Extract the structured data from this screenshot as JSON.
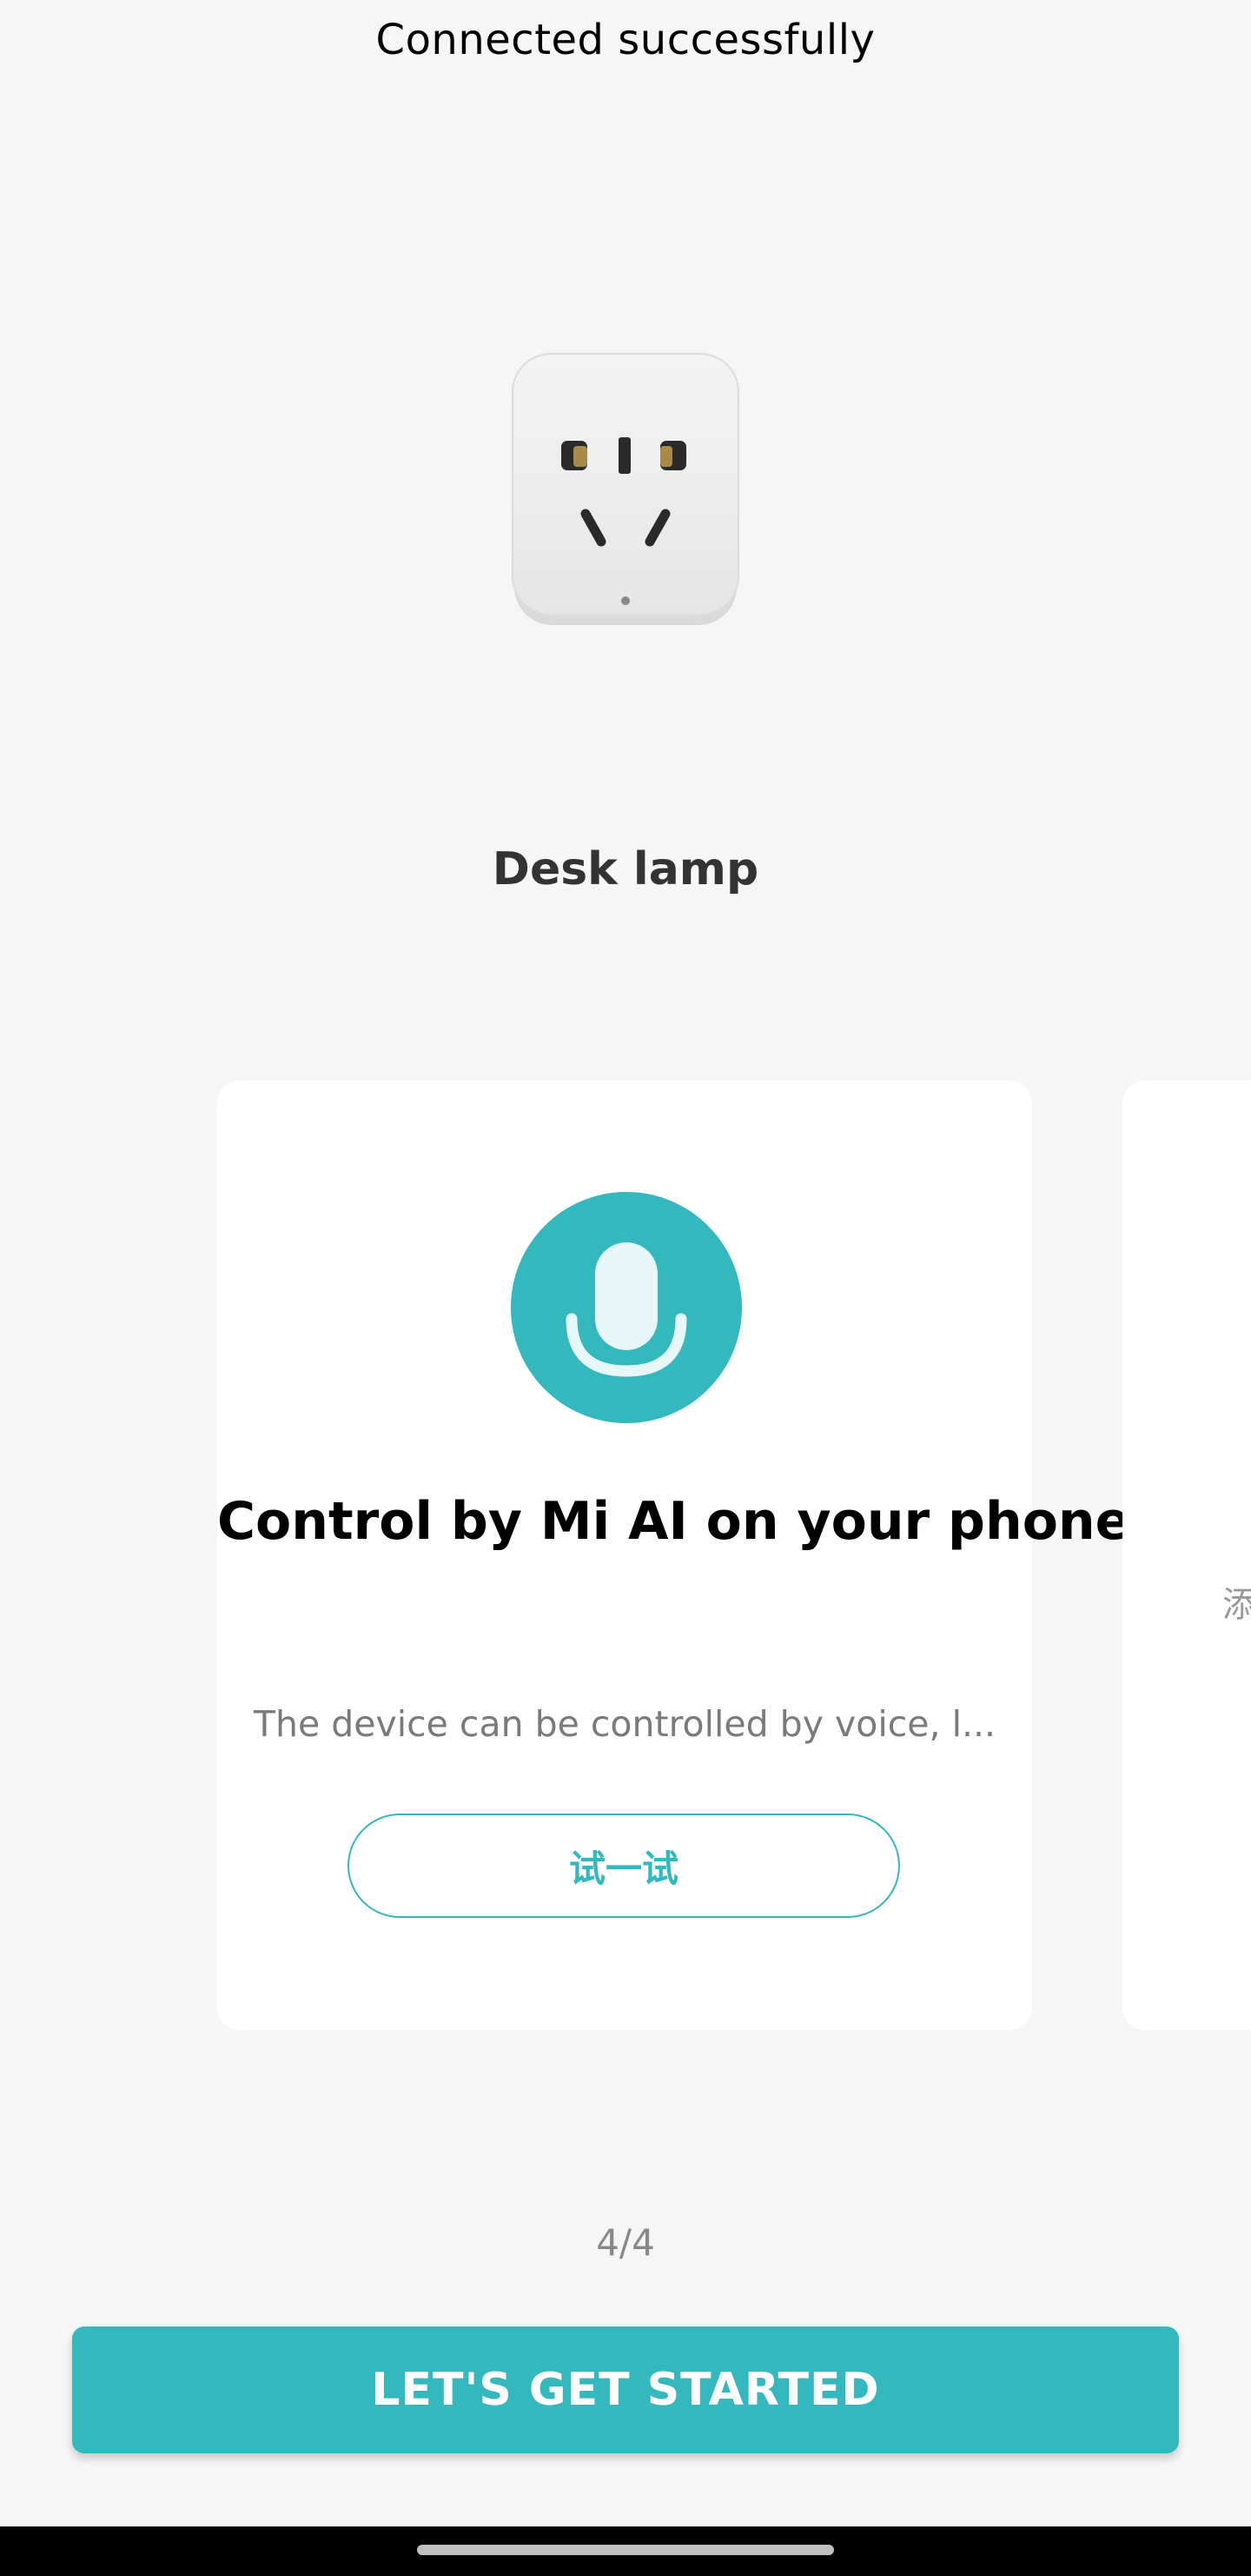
{
  "header": {
    "title": "Connected successfully"
  },
  "device": {
    "name": "Desk lamp",
    "image_icon": "smart-plug-icon"
  },
  "card": {
    "icon": "microphone-icon",
    "title": "Control by Mi AI on your phone",
    "description": "The device can be controlled by voice, l...",
    "button_label": "试一试"
  },
  "next_card": {
    "partial_text": "添"
  },
  "pagination": {
    "label": "4/4"
  },
  "footer": {
    "start_button_label": "LET'S GET STARTED"
  },
  "colors": {
    "accent": "#33b8bd",
    "background": "#f6f6f6"
  }
}
